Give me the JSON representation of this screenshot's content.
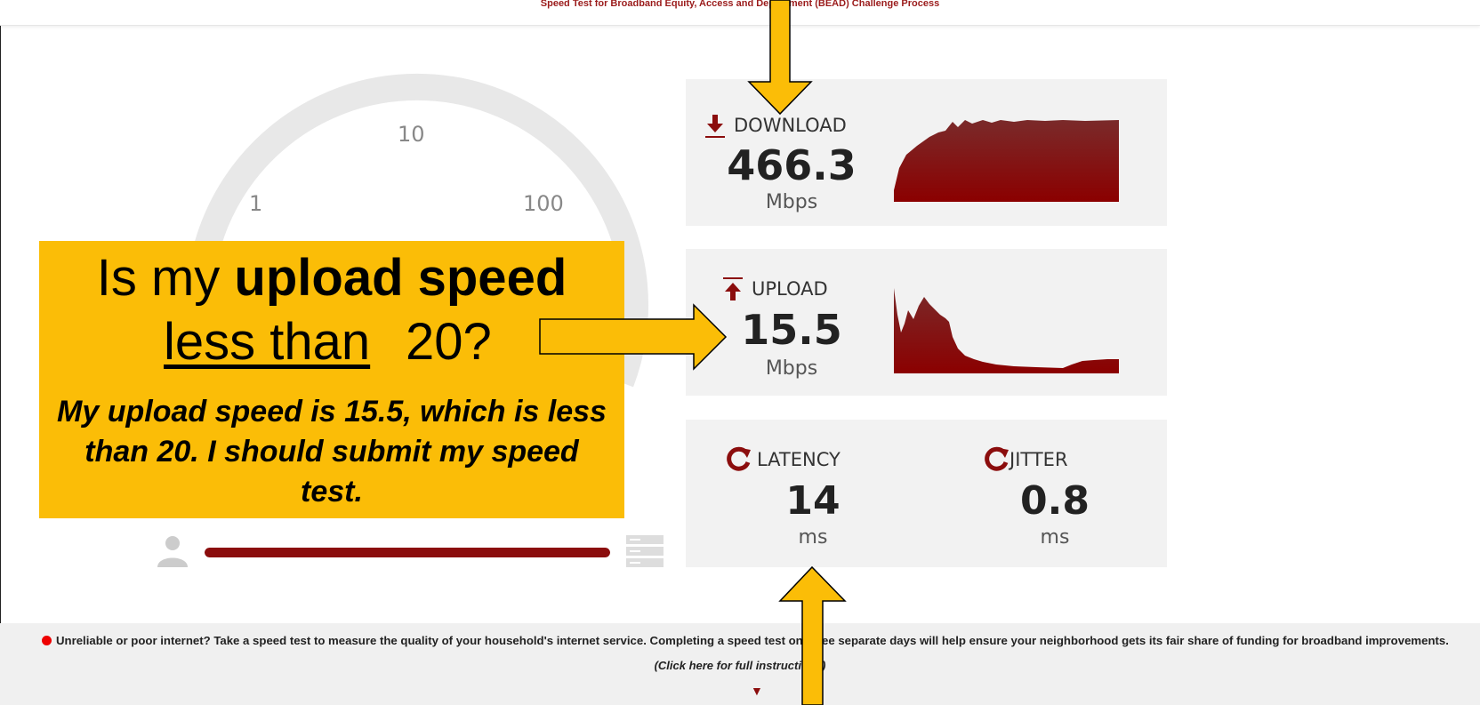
{
  "page": {
    "title": "Speed Test for Broadband Equity, Access and Deployment (BEAD) Challenge Process"
  },
  "gauge": {
    "scale_labels": [
      "1",
      "10",
      "100"
    ]
  },
  "progress": {
    "value": 1.0,
    "color": "#8b0d0d"
  },
  "download": {
    "icon": "download-arrow-icon",
    "label": "DOWNLOAD",
    "value": "466.3",
    "unit": "Mbps"
  },
  "upload": {
    "icon": "upload-arrow-icon",
    "label": "UPLOAD",
    "value": "15.5",
    "unit": "Mbps"
  },
  "latency": {
    "icon": "refresh-icon",
    "label": "LATENCY",
    "value": "14",
    "unit": "ms"
  },
  "jitter": {
    "icon": "refresh-icon",
    "label": "JITTER",
    "value": "0.8",
    "unit": "ms"
  },
  "callout": {
    "q_prefix": "Is my ",
    "q_bold": "upload speed",
    "q_underline": "less than",
    "q_number": "20?",
    "answer": "My upload speed is 15.5, which is less than 20. I should submit my speed test."
  },
  "footer": {
    "message": "Unreliable or poor internet? Take a speed test to measure the quality of your household's internet service. Completing a speed test on three separate days will help ensure your neighborhood gets its fair share of funding for broadband improvements.",
    "link": "(Click here for full instructions)",
    "status_color": "#e00000"
  },
  "colors": {
    "accent": "#8b0d0d",
    "callout": "#fbbd07",
    "panel": "#f2f2f2"
  }
}
